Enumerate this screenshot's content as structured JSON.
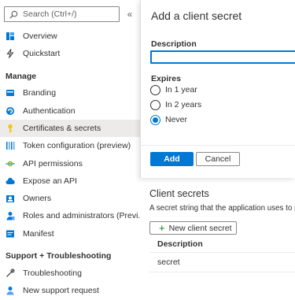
{
  "sidebar": {
    "search_placeholder": "Search (Ctrl+/)",
    "collapse_glyph": "«",
    "items_top": [
      {
        "label": "Overview",
        "icon": "overview-icon",
        "selected": false
      },
      {
        "label": "Quickstart",
        "icon": "quickstart-icon",
        "selected": false
      }
    ],
    "section_manage": "Manage",
    "items_manage": [
      {
        "label": "Branding",
        "icon": "branding-icon",
        "selected": false
      },
      {
        "label": "Authentication",
        "icon": "authentication-icon",
        "selected": false
      },
      {
        "label": "Certificates & secrets",
        "icon": "key-icon",
        "selected": true
      },
      {
        "label": "Token configuration (preview)",
        "icon": "token-icon",
        "selected": false
      },
      {
        "label": "API permissions",
        "icon": "api-permissions-icon",
        "selected": false
      },
      {
        "label": "Expose an API",
        "icon": "cloud-icon",
        "selected": false
      },
      {
        "label": "Owners",
        "icon": "owners-icon",
        "selected": false
      },
      {
        "label": "Roles and administrators (Previ...",
        "icon": "roles-icon",
        "selected": false
      },
      {
        "label": "Manifest",
        "icon": "manifest-icon",
        "selected": false
      }
    ],
    "section_support": "Support + Troubleshooting",
    "items_support": [
      {
        "label": "Troubleshooting",
        "icon": "wrench-icon",
        "selected": false
      },
      {
        "label": "New support request",
        "icon": "support-person-icon",
        "selected": false
      }
    ]
  },
  "panel": {
    "title": "Add a client secret",
    "description_label": "Description",
    "description_value": "",
    "expires_label": "Expires",
    "options": [
      {
        "label": "In 1 year",
        "checked": false
      },
      {
        "label": "In 2 years",
        "checked": false
      },
      {
        "label": "Never",
        "checked": true
      }
    ],
    "add_label": "Add",
    "cancel_label": "Cancel"
  },
  "main": {
    "client_secrets_heading": "Client secrets",
    "info_text": "A secret string that the application uses to pro",
    "new_secret_label": "New client secret",
    "table_header_description": "Description",
    "rows": [
      {
        "description": "secret"
      }
    ]
  },
  "colors": {
    "accent": "#0078d4",
    "selected_bg": "#edebe9",
    "plus_green": "#107c10"
  }
}
